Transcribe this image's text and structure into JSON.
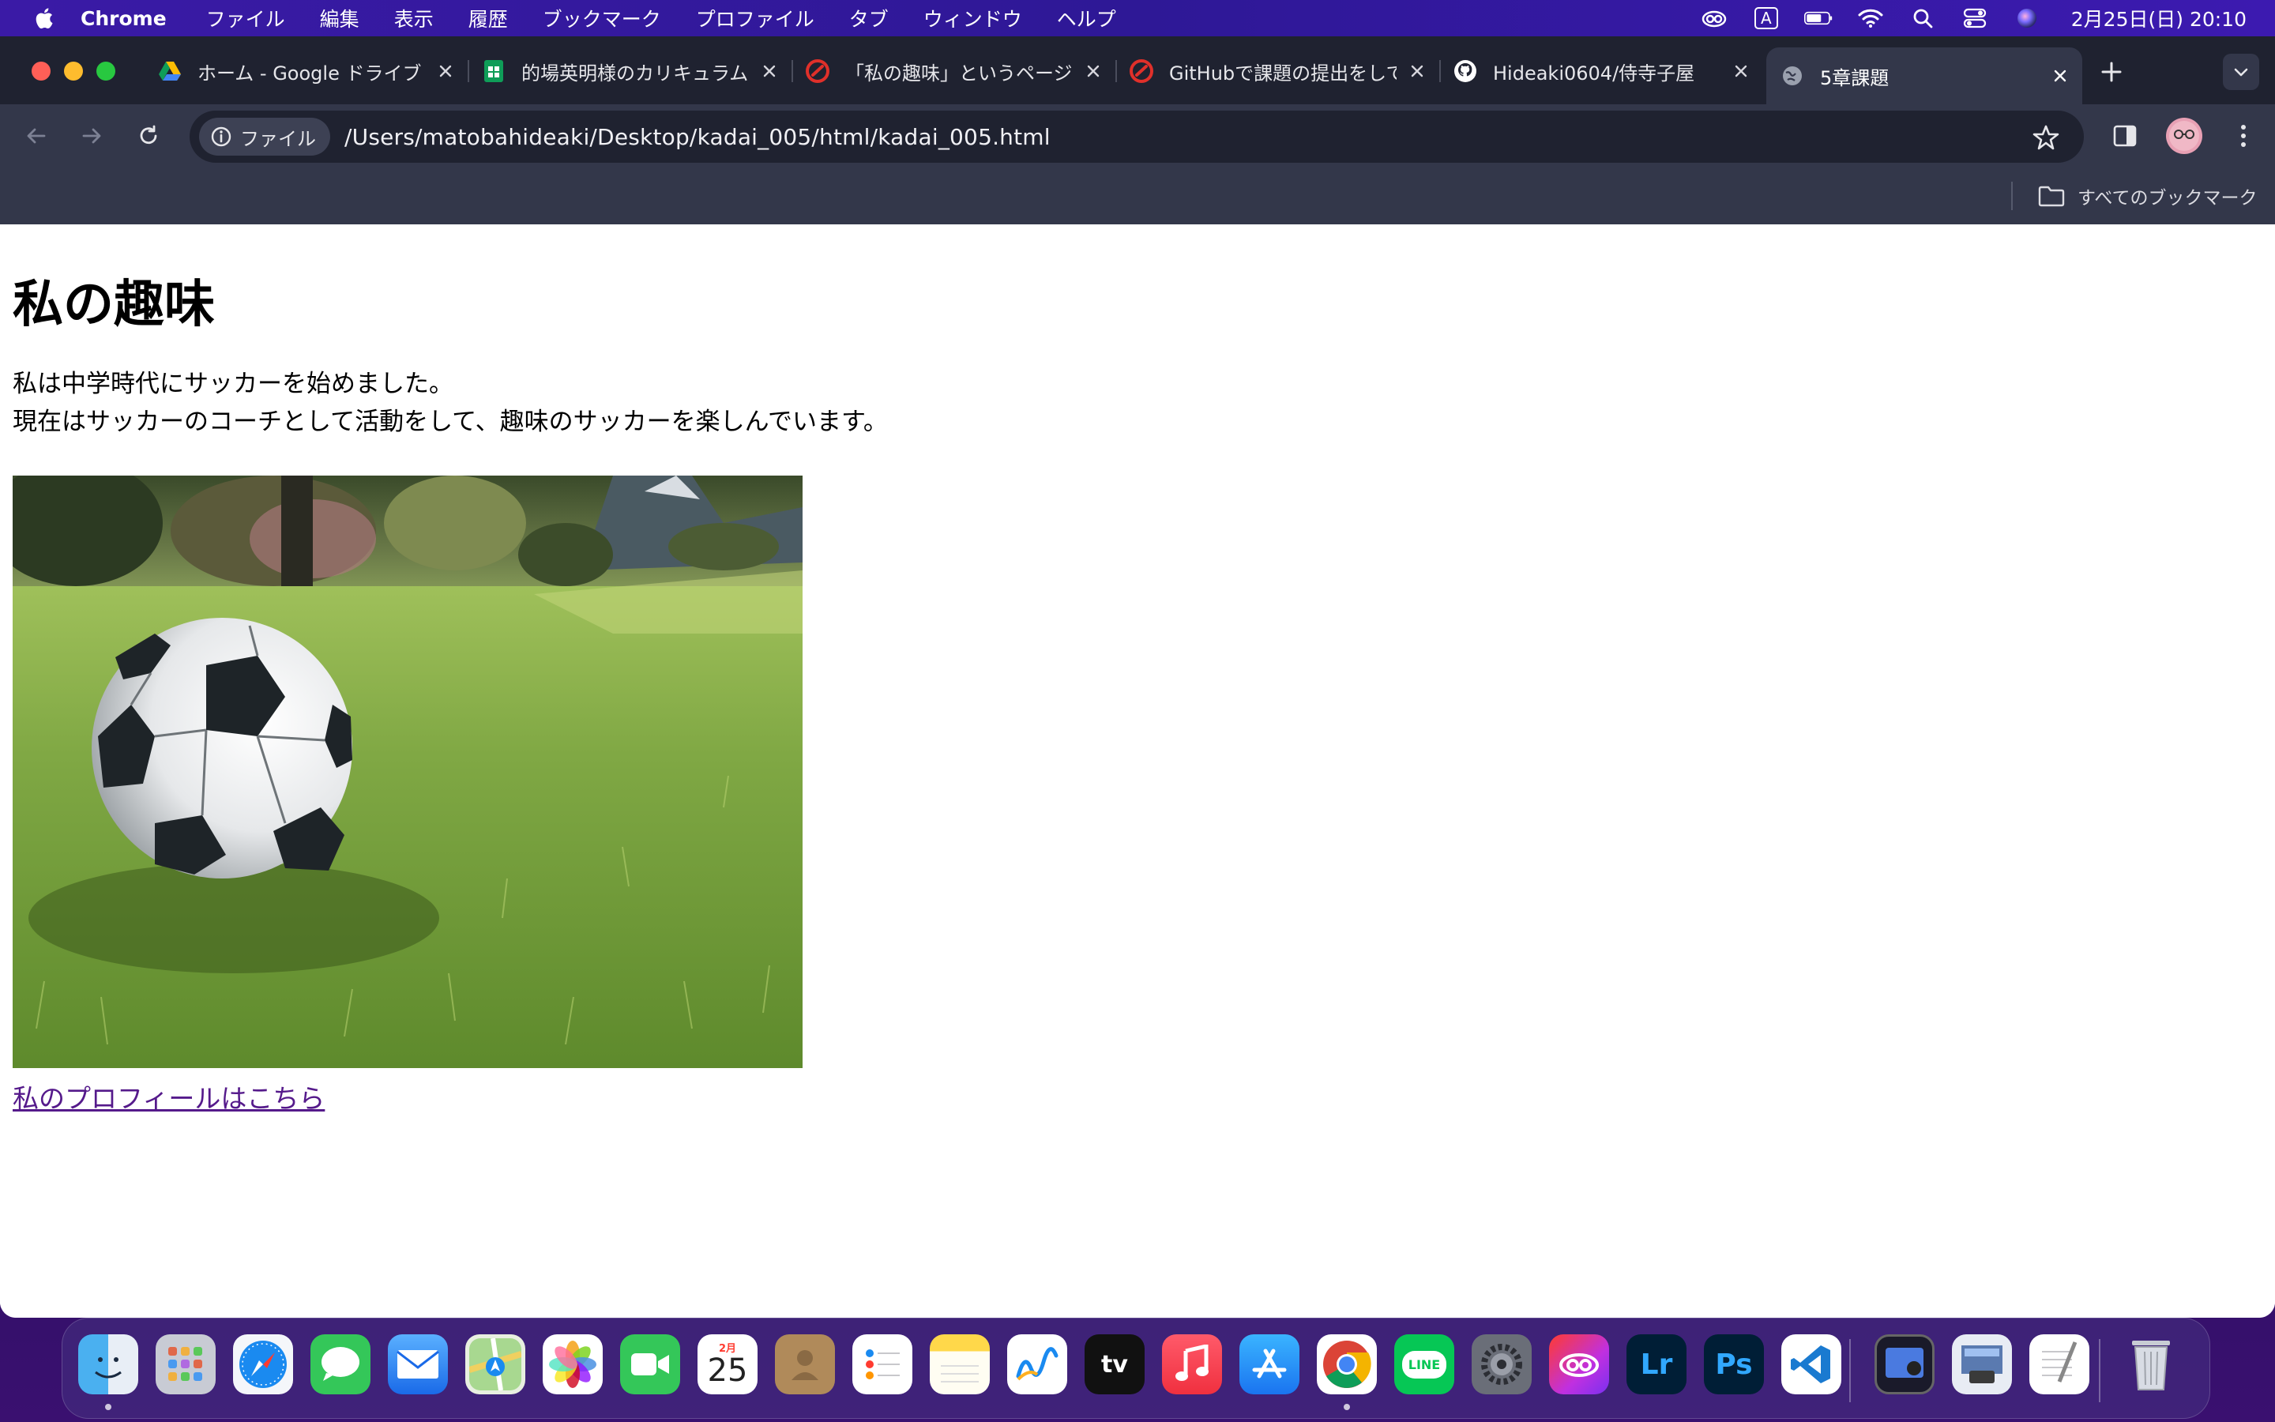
{
  "menubar": {
    "app_name": "Chrome",
    "menus": [
      "ファイル",
      "編集",
      "表示",
      "履歴",
      "ブックマーク",
      "プロファイル",
      "タブ",
      "ウィンドウ",
      "ヘルプ"
    ],
    "input_mode": "A",
    "clock": "2月25日(日)  20:10"
  },
  "tabs": [
    {
      "title": "ホーム - Google ドライブ",
      "icon": "google-drive-icon"
    },
    {
      "title": "的場英明様のカリキュラム",
      "icon": "google-sheets-icon"
    },
    {
      "title": "「私の趣味」というページ",
      "icon": "samurai-terakoya-icon"
    },
    {
      "title": "GitHubで課題の提出をして",
      "icon": "samurai-terakoya-icon"
    },
    {
      "title": "Hideaki0604/侍寺子屋",
      "icon": "github-icon"
    },
    {
      "title": "5章課題",
      "icon": "globe-icon",
      "active": true
    }
  ],
  "toolbar": {
    "chip_label": "ファイル",
    "url": "/Users/matobahideaki/Desktop/kadai_005/html/kadai_005.html"
  },
  "bookmarks": {
    "all_bookmarks_label": "すべてのブックマーク"
  },
  "page": {
    "heading": "私の趣味",
    "paragraph_line1": "私は中学時代にサッカーを始めました。",
    "paragraph_line2": "現在はサッカーのコーチとして活動をして、趣味のサッカーを楽しんでいます。",
    "image_subject": "soccer ball on grass",
    "link_text": "私のプロフィールはこちら"
  },
  "dock": {
    "calendar_month": "2月",
    "calendar_day": "25",
    "tv_label": "tv",
    "line_label": "LINE",
    "lr_label": "Lr",
    "ps_label": "Ps",
    "apps": [
      "finder-icon",
      "launchpad-icon",
      "safari-icon",
      "messages-icon",
      "mail-icon",
      "maps-icon",
      "photos-icon",
      "facetime-icon",
      "calendar-icon",
      "contacts-icon",
      "reminders-icon",
      "notes-icon",
      "freeform-icon",
      "apple-tv-icon",
      "music-icon",
      "app-store-icon",
      "chrome-icon",
      "line-icon",
      "system-settings-icon",
      "creative-cloud-icon",
      "lightroom-icon",
      "photoshop-icon",
      "vscode-icon",
      "preview-icon",
      "script-editor-icon",
      "textedit-icon",
      "trash-icon"
    ]
  },
  "colors": {
    "tab_strip": "#1f2230",
    "toolbar": "#33374a",
    "link_visited": "#551a8b",
    "menubar": "#3a1aa6"
  }
}
